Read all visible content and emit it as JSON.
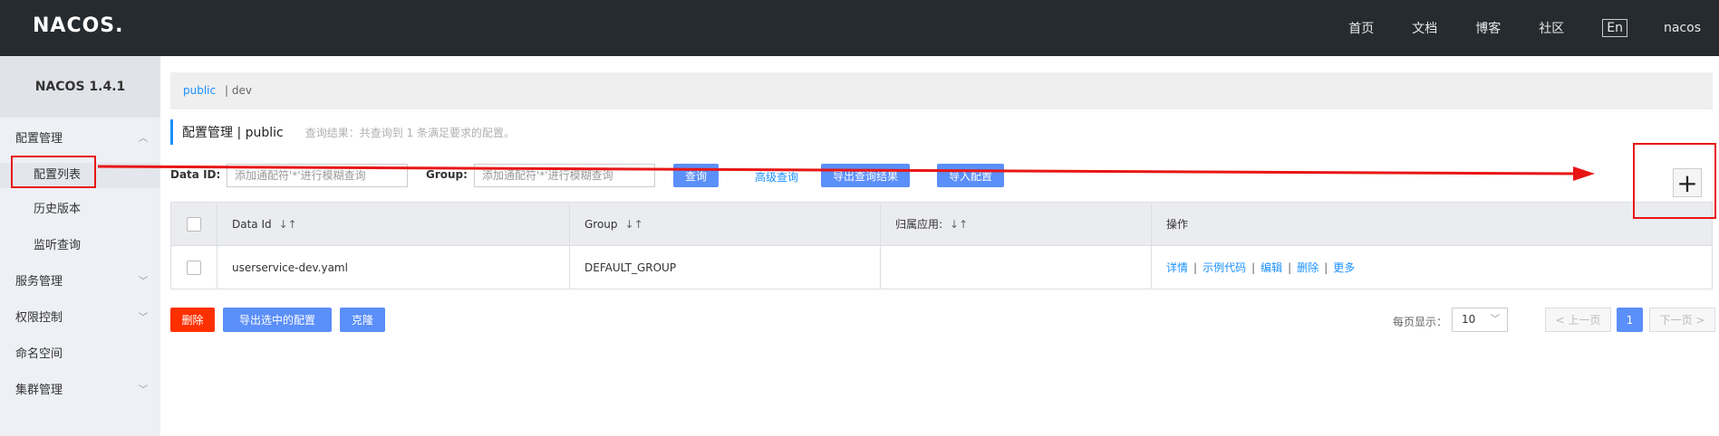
{
  "topbar": {
    "logo": "NACOS.",
    "nav": [
      "首页",
      "文档",
      "博客",
      "社区"
    ],
    "lang": "En",
    "user": "nacos"
  },
  "sidebar": {
    "title": "NACOS 1.4.1",
    "config_group": "配置管理",
    "config_list": "配置列表",
    "history": "历史版本",
    "listener": "监听查询",
    "service": "服务管理",
    "auth": "权限控制",
    "namespace": "命名空间",
    "cluster": "集群管理"
  },
  "breadcrumb": {
    "namespace": "public",
    "other": "| dev"
  },
  "header": {
    "title": "配置管理 | public",
    "result": "查询结果：共查询到 1 条满足要求的配置。"
  },
  "filters": {
    "dataid_label": "Data ID:",
    "dataid_placeholder": "添加通配符'*'进行模糊查询",
    "group_label": "Group:",
    "group_placeholder": "添加通配符'*'进行模糊查询",
    "query": "查询",
    "advanced": "高级查询",
    "export_results": "导出查询结果",
    "import": "导入配置",
    "add": "+"
  },
  "table": {
    "headers": [
      "Data Id",
      "Group",
      "归属应用:",
      "操作"
    ],
    "sort_icon": "↓↑",
    "rows": [
      {
        "data_id": "userservice-dev.yaml",
        "group": "DEFAULT_GROUP",
        "app": ""
      }
    ],
    "ops": [
      "详情",
      "示例代码",
      "编辑",
      "删除",
      "更多"
    ]
  },
  "bottom": {
    "delete": "删除",
    "export_selected": "导出选中的配置",
    "clone": "克隆"
  },
  "pager": {
    "per_page_label": "每页显示：",
    "per_page": "10",
    "prev": "< 上一页",
    "current": "1",
    "next": "下一页 >"
  },
  "colors": {
    "accent": "#5b8ff9",
    "danger": "#ff3000",
    "annotation": "#e81616",
    "topbar": "#262b2f"
  }
}
